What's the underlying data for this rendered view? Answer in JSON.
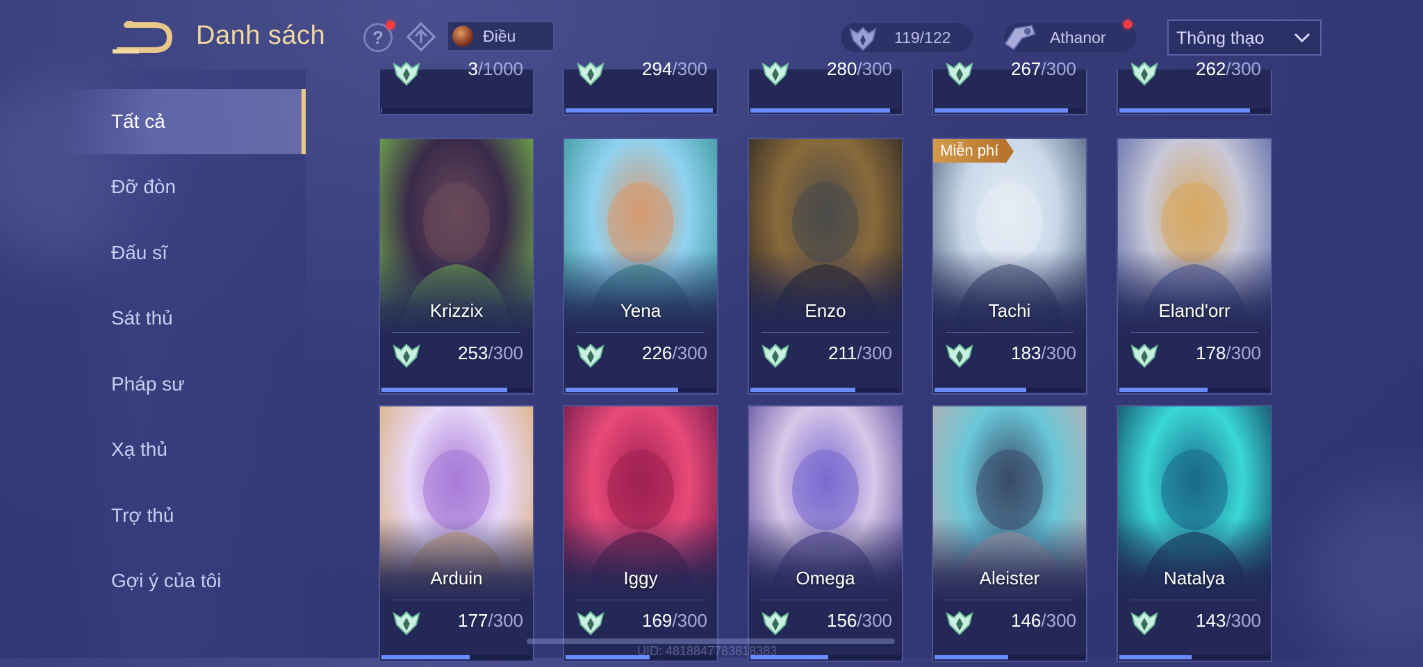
{
  "header": {
    "title": "Danh sách",
    "help_label": "?",
    "selected_hero": "Điều",
    "mastery_count": "119/122",
    "rank_name": "Athanor",
    "sort_value": "Thông thạo"
  },
  "sidebar": {
    "items": [
      {
        "label": "Tất cả",
        "active": true
      },
      {
        "label": "Đỡ đòn"
      },
      {
        "label": "Đấu sĩ"
      },
      {
        "label": "Sát thủ"
      },
      {
        "label": "Pháp sư"
      },
      {
        "label": "Xạ thủ"
      },
      {
        "label": "Trợ thủ"
      },
      {
        "label": "Gợi ý của tôi"
      }
    ]
  },
  "partial_row": [
    {
      "current": "3",
      "max": "/1000",
      "fill": 0.003
    },
    {
      "current": "294",
      "max": "/300",
      "fill": 0.98
    },
    {
      "current": "280",
      "max": "/300",
      "fill": 0.93
    },
    {
      "current": "267",
      "max": "/300",
      "fill": 0.89
    },
    {
      "current": "262",
      "max": "/300",
      "fill": 0.87
    }
  ],
  "heroes": [
    {
      "name": "Krizzix",
      "current": "253",
      "max": "/300",
      "fill": 0.84,
      "colors": [
        "#3a2a4a",
        "#6a4a5a",
        "#7fd04a"
      ]
    },
    {
      "name": "Yena",
      "current": "226",
      "max": "/300",
      "fill": 0.75,
      "colors": [
        "#8fd2f0",
        "#d79a70",
        "#2a8a8a"
      ]
    },
    {
      "name": "Enzo",
      "current": "211",
      "max": "/300",
      "fill": 0.7,
      "colors": [
        "#8a6a3a",
        "#4a4a4a",
        "#1e1e24"
      ]
    },
    {
      "name": "Tachi",
      "current": "183",
      "max": "/300",
      "fill": 0.61,
      "free": "Miễn phí",
      "colors": [
        "#c8d8e8",
        "#e6eef6",
        "#3a4a6a"
      ]
    },
    {
      "name": "Eland'orr",
      "current": "178",
      "max": "/300",
      "fill": 0.59,
      "colors": [
        "#c8c8d8",
        "#d8a860",
        "#4a5aa0"
      ]
    },
    {
      "name": "Arduin",
      "current": "177",
      "max": "/300",
      "fill": 0.59,
      "colors": [
        "#e8d8f8",
        "#a87ad8",
        "#d8a860"
      ]
    },
    {
      "name": "Iggy",
      "current": "169",
      "max": "/300",
      "fill": 0.56,
      "colors": [
        "#e84a7a",
        "#a02050",
        "#5a1040"
      ]
    },
    {
      "name": "Omega",
      "current": "156",
      "max": "/300",
      "fill": 0.52,
      "colors": [
        "#d8c8e8",
        "#7a6ad0",
        "#4a3a90"
      ]
    },
    {
      "name": "Aleister",
      "current": "146",
      "max": "/300",
      "fill": 0.49,
      "colors": [
        "#6ac8d8",
        "#3a4a6a",
        "#c8a8a8"
      ]
    },
    {
      "name": "Natalya",
      "current": "143",
      "max": "/300",
      "fill": 0.48,
      "colors": [
        "#3ad8d8",
        "#1a6a8a",
        "#0a2a4a"
      ]
    }
  ],
  "uid": "UID: 4818847783818383"
}
